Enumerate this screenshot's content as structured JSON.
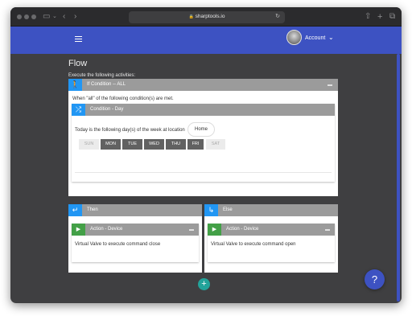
{
  "browser": {
    "url": "sharptools.io",
    "lock_icon": "lock-icon",
    "reload_icon": "reload-icon"
  },
  "appbar": {
    "menu_icon": "hamburger-menu-icon",
    "account_label": "Account",
    "account_chevron": "chevron-down-icon"
  },
  "page": {
    "title": "Flow",
    "subtitle": "Execute the following activities:"
  },
  "if_block": {
    "icon": "walking-person-icon",
    "title": "If Condition -- ALL",
    "description": "When \"all\" of the following condition(s) are met.",
    "condition": {
      "icon": "shuffle-icon",
      "title": "Condition - Day",
      "text": "Today is the following day(s) of the week at location",
      "location": "Home",
      "days": [
        {
          "label": "SUN",
          "selected": false
        },
        {
          "label": "MON",
          "selected": true
        },
        {
          "label": "TUE",
          "selected": true
        },
        {
          "label": "WED",
          "selected": true
        },
        {
          "label": "THU",
          "selected": true
        },
        {
          "label": "FRI",
          "selected": true
        },
        {
          "label": "SAT",
          "selected": false
        }
      ]
    }
  },
  "then_block": {
    "icon": "return-arrow-icon",
    "title": "Then",
    "action": {
      "icon": "play-icon",
      "title": "Action - Device",
      "text": "Virtual Valve to execute command close"
    }
  },
  "else_block": {
    "icon": "turn-right-arrow-icon",
    "title": "Else",
    "action": {
      "icon": "play-icon",
      "title": "Action - Device",
      "text": "Virtual Valve to execute command open"
    }
  },
  "fab": {
    "add_label": "+",
    "help_label": "?"
  },
  "colors": {
    "appbar": "#3d52c2",
    "page_bg": "#3f3f41",
    "condition_accent": "#2196f3",
    "action_accent": "#43a047",
    "add_fab": "#22a39a"
  }
}
